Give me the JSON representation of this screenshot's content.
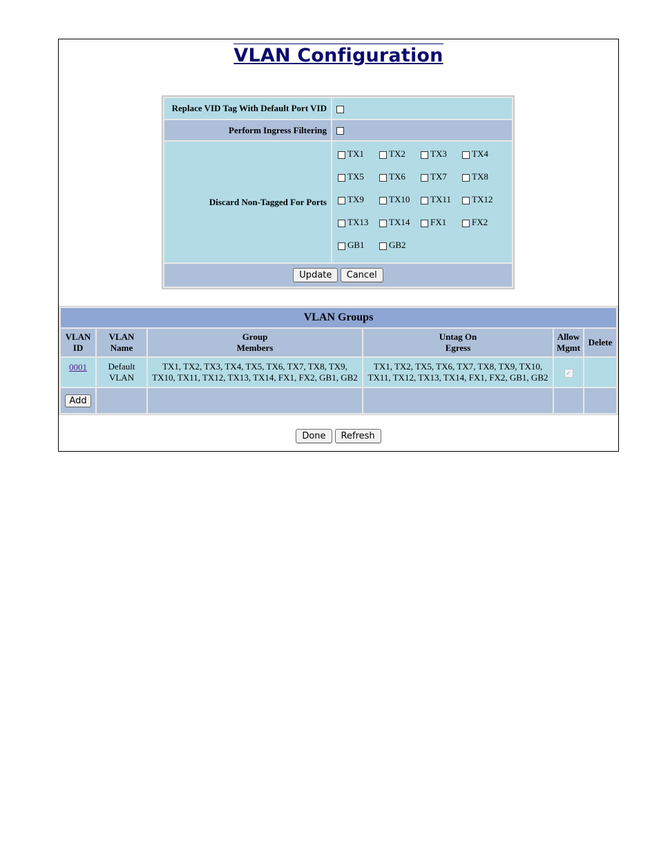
{
  "page_title": "VLAN Configuration",
  "config": {
    "replace_vid_label": "Replace VID Tag With Default Port VID",
    "ingress_label": "Perform Ingress Filtering",
    "discard_label": "Discard Non-Tagged For Ports",
    "ports": [
      "TX1",
      "TX2",
      "TX3",
      "TX4",
      "TX5",
      "TX6",
      "TX7",
      "TX8",
      "TX9",
      "TX10",
      "TX11",
      "TX12",
      "TX13",
      "TX14",
      "FX1",
      "FX2",
      "GB1",
      "GB2"
    ],
    "update_label": "Update",
    "cancel_label": "Cancel"
  },
  "groups": {
    "title": "VLAN Groups",
    "headers": {
      "vlan_id_1": "VLAN",
      "vlan_id_2": "ID",
      "vlan_name_1": "VLAN",
      "vlan_name_2": "Name",
      "members_1": "Group",
      "members_2": "Members",
      "untag_1": "Untag On",
      "untag_2": "Egress",
      "mgmt_1": "Allow",
      "mgmt_2": "Mgmt",
      "delete": "Delete"
    },
    "rows": [
      {
        "vlan_id": "0001",
        "name_1": "Default",
        "name_2": "VLAN",
        "members": "TX1, TX2, TX3, TX4, TX5, TX6, TX7, TX8, TX9, TX10, TX11, TX12, TX13, TX14, FX1, FX2, GB1, GB2",
        "untag": "TX1, TX2, TX5, TX6, TX7, TX8, TX9, TX10, TX11, TX12, TX13, TX14, FX1, FX2, GB1, GB2"
      }
    ],
    "add_label": "Add"
  },
  "done_label": "Done",
  "refresh_label": "Refresh"
}
